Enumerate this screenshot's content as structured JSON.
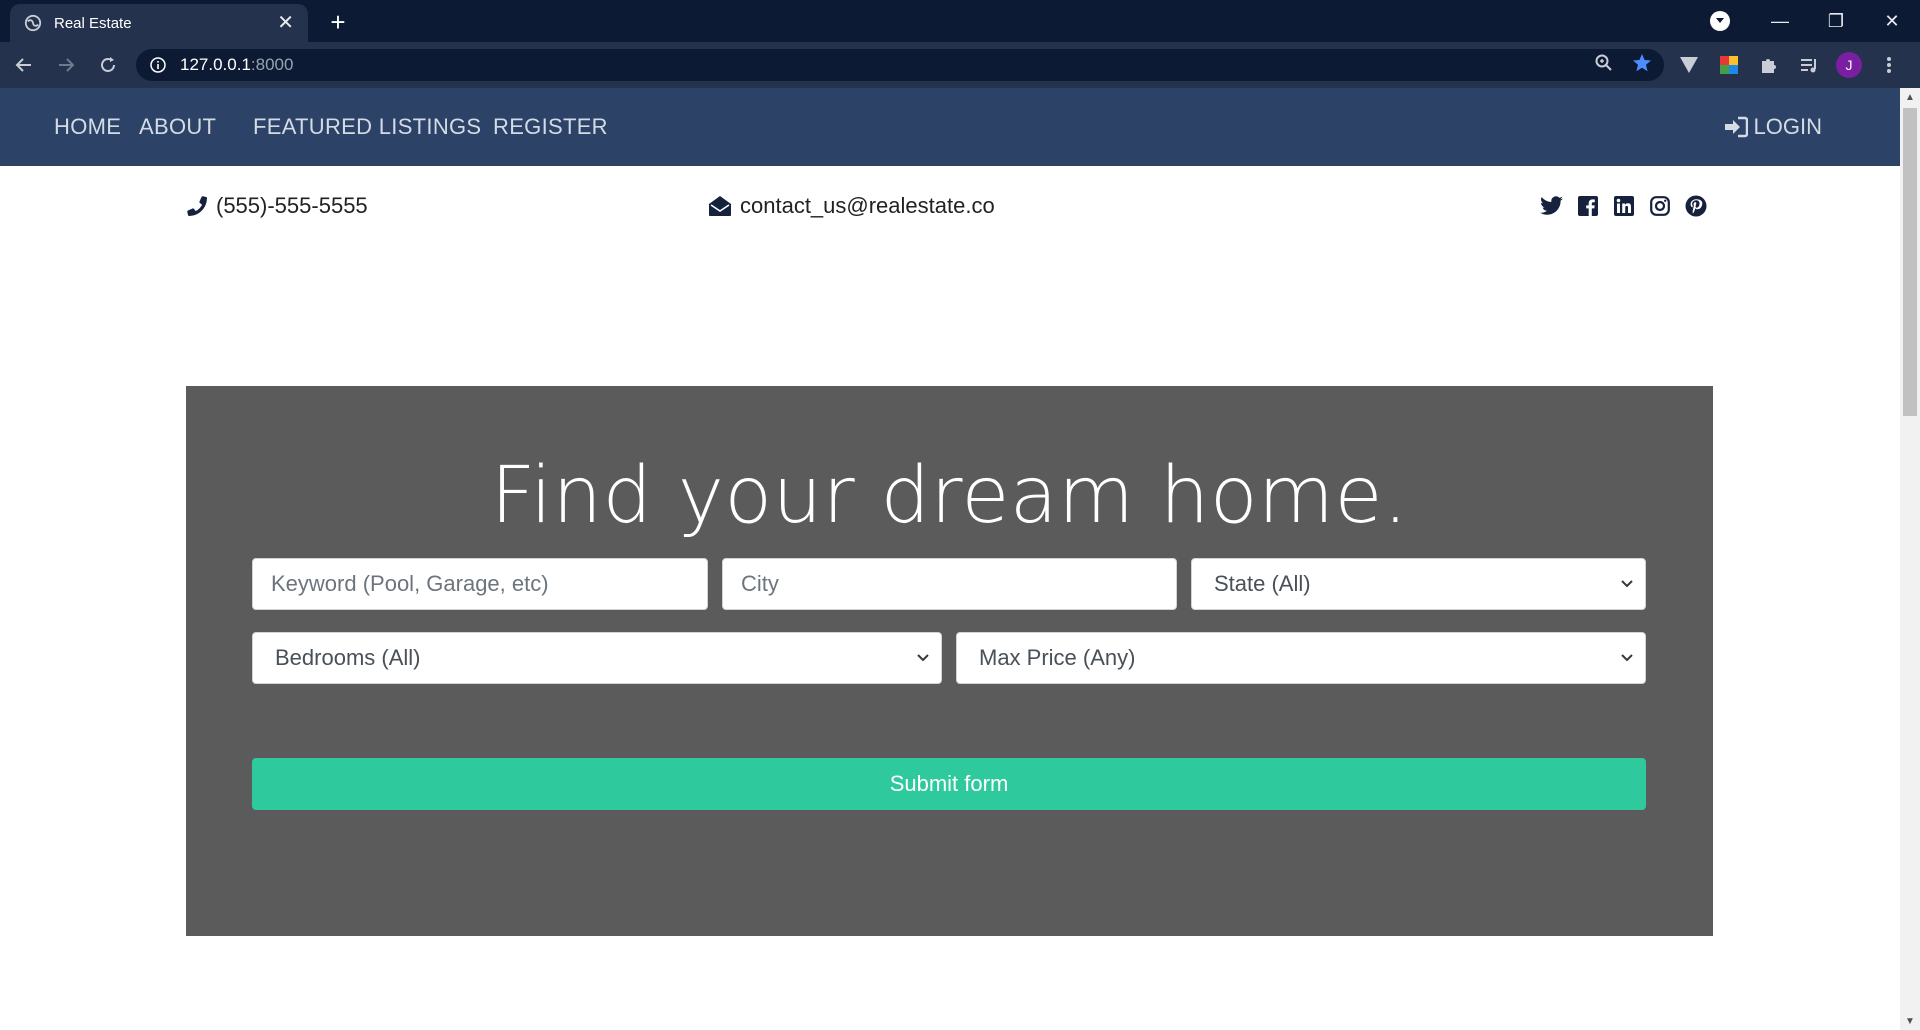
{
  "browser": {
    "tab_title": "Real Estate",
    "url_host": "127.0.0.1",
    "url_port": ":8000",
    "profile_initial": "J"
  },
  "nav": {
    "home": "HOME",
    "about": "ABOUT",
    "featured": "FEATURED LISTINGS",
    "register": "REGISTER",
    "login": "LOGIN"
  },
  "contact": {
    "phone": "(555)-555-5555",
    "email": "contact_us@realestate.co"
  },
  "socials": [
    "twitter-icon",
    "facebook-icon",
    "linkedin-icon",
    "instagram-icon",
    "pinterest-icon"
  ],
  "hero": {
    "title": "Find your dream home.",
    "keyword_placeholder": "Keyword (Pool, Garage, etc)",
    "city_placeholder": "City",
    "state_value": "State (All)",
    "bedrooms_value": "Bedrooms (All)",
    "max_price_value": "Max Price (Any)",
    "submit_label": "Submit form"
  },
  "colors": {
    "nav_bg": "#2c4266",
    "hero_bg": "#5b5b5b",
    "submit_bg": "#2fc99e"
  }
}
